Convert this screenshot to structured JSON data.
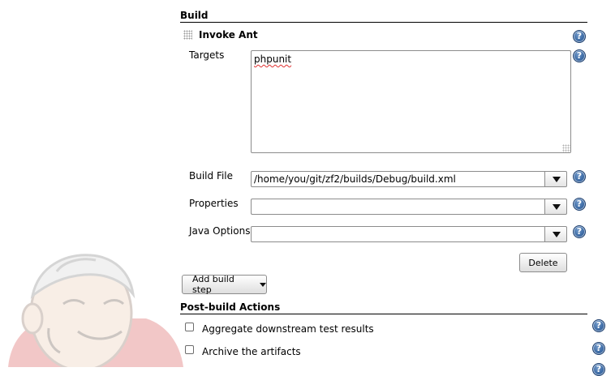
{
  "build": {
    "section_title": "Build",
    "step": {
      "title": "Invoke Ant",
      "targets_label": "Targets",
      "targets_value": "phpunit",
      "build_file_label": "Build File",
      "build_file_value": "/home/you/git/zf2/builds/Debug/build.xml",
      "properties_label": "Properties",
      "properties_value": "",
      "java_options_label": "Java Options",
      "java_options_value": "",
      "delete_label": "Delete"
    },
    "add_build_step_label": "Add build step"
  },
  "post_build": {
    "section_title": "Post-build Actions",
    "actions": [
      {
        "label": "Aggregate downstream test results",
        "checked": false
      },
      {
        "label": "Archive the artifacts",
        "checked": false
      }
    ]
  },
  "help_icon_glyph": "?",
  "colors": {
    "help_icon": "#3e6ca6",
    "mascot_face": "#f2d8c4",
    "mascot_body": "#e8a2a2"
  }
}
